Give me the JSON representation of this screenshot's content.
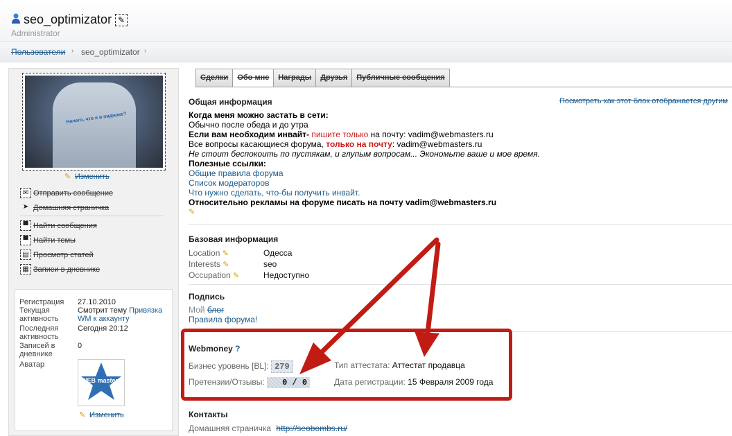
{
  "header": {
    "username": "seo_optimizator",
    "role": "Administrator"
  },
  "breadcrumb": {
    "items": [
      "Пользователи",
      "seo_optimizator"
    ]
  },
  "sidebar": {
    "photo_caption": "Ничего, что я в пиджаке?",
    "edit_photo_label": "Изменить",
    "actions": [
      {
        "label": "Отправить сообщение",
        "icon": "envelope-icon"
      },
      {
        "label": "Домашняя страничка",
        "icon": "cursor-icon"
      },
      {
        "label": "Найти сообщения",
        "icon": "chat-icon"
      },
      {
        "label": "Найти темы",
        "icon": "chat-icon"
      },
      {
        "label": "Просмотр статей",
        "icon": "document-icon"
      },
      {
        "label": "Записи в дневнике",
        "icon": "notebook-icon"
      }
    ],
    "info": {
      "reg_label": "Регистрация",
      "reg_value": "27.10.2010",
      "activity_label": "Текущая активность",
      "activity_value_text": "Смотрит тему",
      "activity_link": "Привязка WM к аккаунту",
      "last_label": "Последняя активность",
      "last_value": "Сегодня 20:12",
      "diary_label": "Записей в дневнике",
      "diary_value": "0",
      "avatar_label": "Аватар",
      "avatar_text": "WEB masters",
      "avatar_edit_label": "Изменить"
    }
  },
  "tabs": [
    {
      "label": "Сделки",
      "active": false
    },
    {
      "label": "Обо мне",
      "active": true
    },
    {
      "label": "Награды",
      "active": false
    },
    {
      "label": "Друзья",
      "active": false
    },
    {
      "label": "Публичные сообщения",
      "active": false
    }
  ],
  "general": {
    "title": "Общая информация",
    "view_as_link": "Посмотреть как этот блок отображается другим",
    "q1": "Когда меня можно застать в сети:",
    "a1": "Обычно после обеда и до утра",
    "l3_bold": "Если вам необходим инвайт-",
    "l3_red": "пишите только",
    "l3_rest": "на почту: vadim@webmasters.ru",
    "l4_start": "Все вопросы касающиеся форума,",
    "l4_red": "только на почту",
    "l4_rest": ": vadim@webmasters.ru",
    "l5": "Не стоит беспокоить по пустякам, и глупым вопросам... Экономьте ваше и мое время.",
    "links_title": "Полезные ссылки:",
    "link1": "Общие правила форума",
    "link2": "Список модераторов",
    "link3": "Что нужно сделать, что-бы получить инвайт.",
    "ads": "Относительно рекламы на форуме писать на почту vadim@webmasters.ru"
  },
  "basic": {
    "title": "Базовая информация",
    "rows": [
      {
        "label": "Location",
        "value": "Одесса"
      },
      {
        "label": "Interests",
        "value": "seo"
      },
      {
        "label": "Occupation",
        "value": "Недоступно"
      }
    ]
  },
  "signature": {
    "title": "Подпись",
    "my": "Мой",
    "blog": "блог",
    "rules": "Правила форума!"
  },
  "webmoney": {
    "title": "Webmoney",
    "help": "?",
    "bl_label": "Бизнес уровень [BL]:",
    "bl_value": "279",
    "claims_label": "Претензии/Отзывы:",
    "claims_value": "0 / 0",
    "attest_label": "Тип аттестата:",
    "attest_value": "Аттестат продавца",
    "reg_label": "Дата регистрации:",
    "reg_value": "15 Февраля 2009 года"
  },
  "contacts": {
    "title": "Контакты",
    "home_label": "Домашняя страничка",
    "home_value": "http://seobombs.ru/"
  },
  "colors": {
    "link": "#1b5c8e",
    "highlight": "#c01c14",
    "red_text": "#d01818"
  }
}
